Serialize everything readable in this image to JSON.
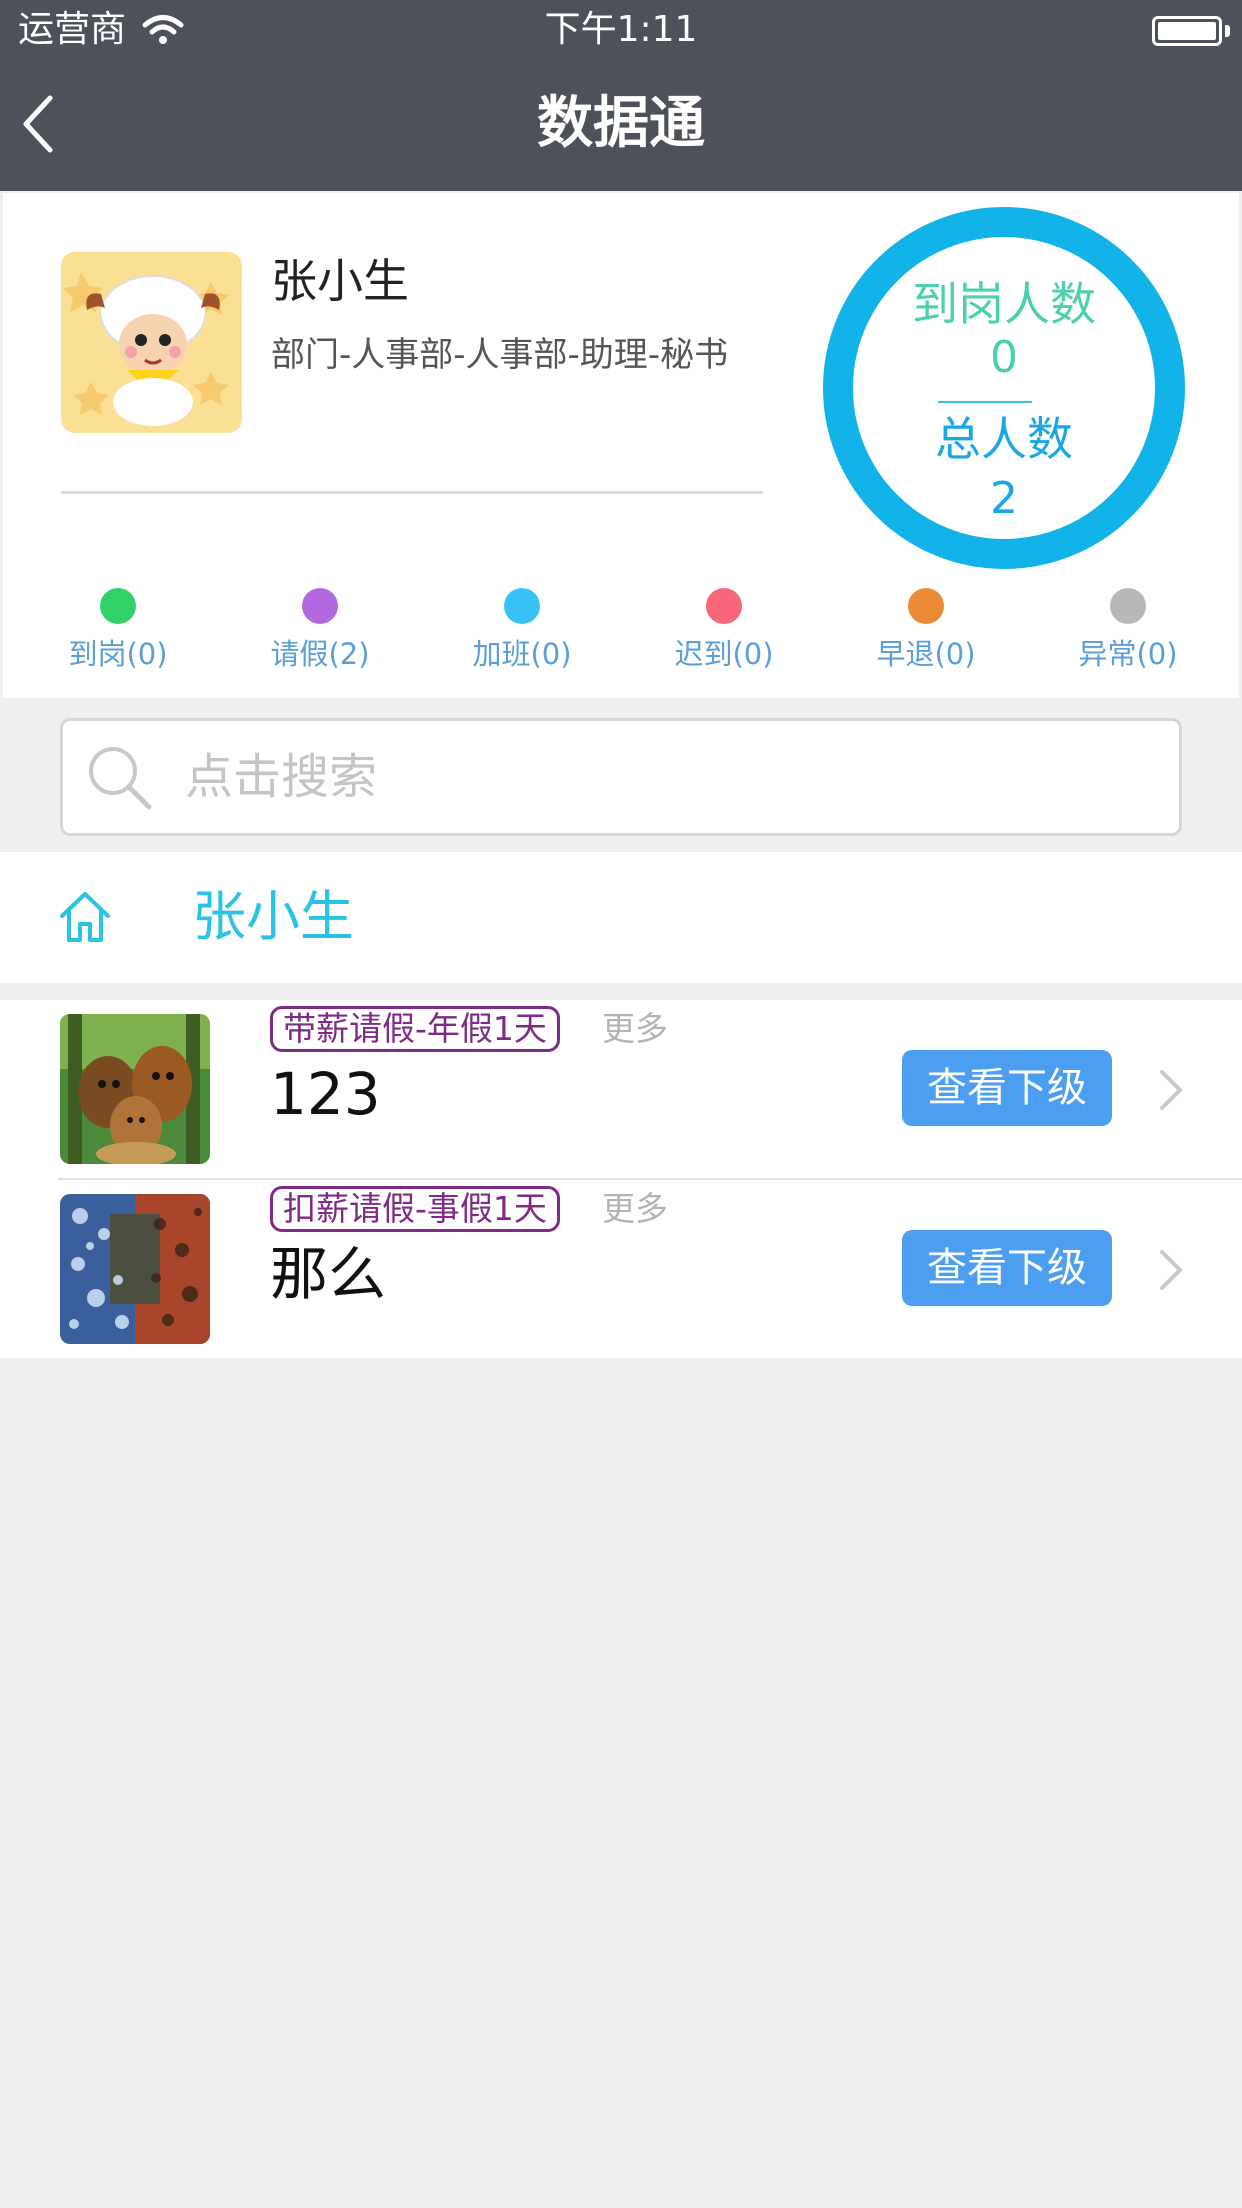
{
  "status_bar": {
    "carrier": "运营商",
    "time": "下午1:11"
  },
  "nav": {
    "title": "数据通"
  },
  "profile": {
    "name": "张小生",
    "department": "部门-人事部-人事部-助理-秘书",
    "ring": {
      "present_label": "到岗人数",
      "present_value": "0",
      "total_label": "总人数",
      "total_value": "2",
      "color": "#12b3e8"
    }
  },
  "legend": [
    {
      "label": "到岗(0)",
      "color": "#33d16a"
    },
    {
      "label": "请假(2)",
      "color": "#b468e0"
    },
    {
      "label": "加班(0)",
      "color": "#36c2f5"
    },
    {
      "label": "迟到(0)",
      "color": "#f86679"
    },
    {
      "label": "早退(0)",
      "color": "#ec8b36"
    },
    {
      "label": "异常(0)",
      "color": "#b8b8b8"
    }
  ],
  "search": {
    "placeholder": "点击搜索"
  },
  "breadcrumb": {
    "label": "张小生"
  },
  "list": [
    {
      "tag": "带薪请假-年假1天",
      "more": "更多",
      "name": "123",
      "button": "查看下级"
    },
    {
      "tag": "扣薪请假-事假1天",
      "more": "更多",
      "name": "那么",
      "button": "查看下级"
    }
  ]
}
